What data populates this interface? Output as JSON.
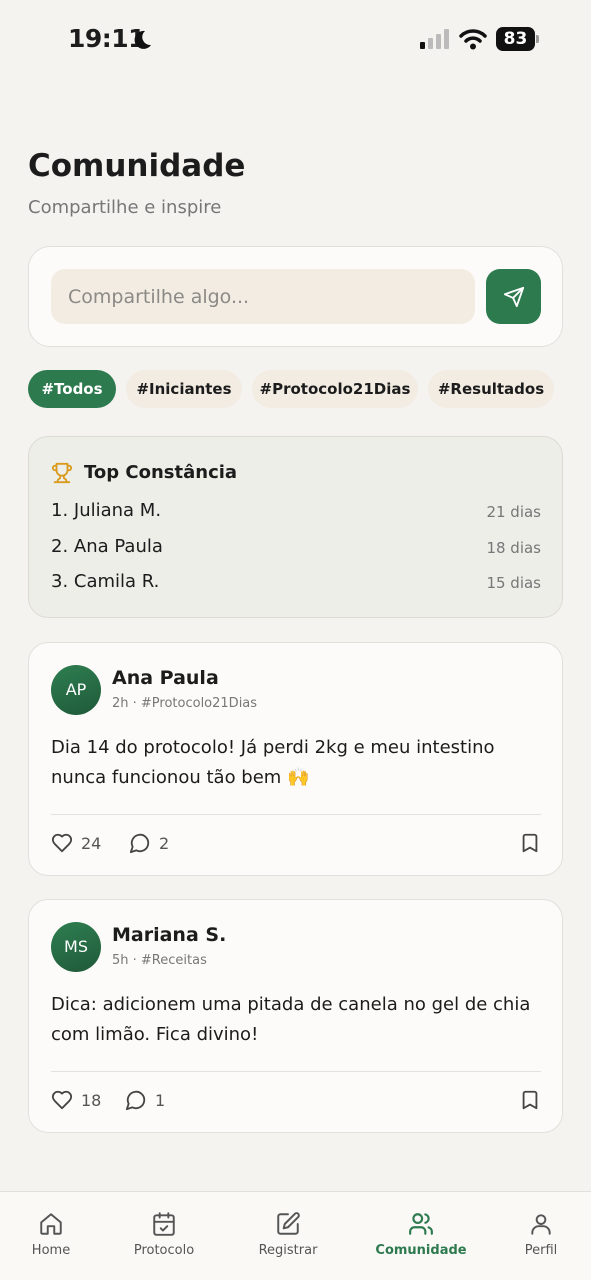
{
  "status_bar": {
    "time": "19:11",
    "battery": "83"
  },
  "header": {
    "title": "Comunidade",
    "subtitle": "Compartilhe e inspire"
  },
  "composer": {
    "placeholder": "Compartilhe algo..."
  },
  "tags": [
    {
      "label": "#Todos",
      "active": true
    },
    {
      "label": "#Iniciantes",
      "active": false
    },
    {
      "label": "#Protocolo21Dias",
      "active": false
    },
    {
      "label": "#Resultados",
      "active": false
    }
  ],
  "top_card": {
    "title": "Top Constância",
    "ranking": [
      {
        "name": "1. Juliana M.",
        "days": "21 dias"
      },
      {
        "name": "2. Ana Paula",
        "days": "18 dias"
      },
      {
        "name": "3. Camila R.",
        "days": "15 dias"
      }
    ]
  },
  "posts": [
    {
      "initials": "AP",
      "author": "Ana Paula",
      "meta": "2h · #Protocolo21Dias",
      "text": "Dia 14 do protocolo! Já perdi 2kg e meu intestino nunca funcionou tão bem 🙌",
      "likes": "24",
      "comments": "2"
    },
    {
      "initials": "MS",
      "author": "Mariana S.",
      "meta": "5h · #Receitas",
      "text": "Dica: adicionem uma pitada de canela no gel de chia com limão. Fica divino!",
      "likes": "18",
      "comments": "1"
    }
  ],
  "nav": [
    {
      "label": "Home",
      "icon": "home-icon",
      "active": false
    },
    {
      "label": "Protocolo",
      "icon": "calendar-check-icon",
      "active": false
    },
    {
      "label": "Registrar",
      "icon": "edit-icon",
      "active": false
    },
    {
      "label": "Comunidade",
      "icon": "users-icon",
      "active": true
    },
    {
      "label": "Perfil",
      "icon": "user-icon",
      "active": false
    }
  ],
  "colors": {
    "accent": "#2e7a4f",
    "background": "#f5f3ef",
    "tag_bg": "#f2ece3",
    "trophy": "#d99a1e"
  }
}
